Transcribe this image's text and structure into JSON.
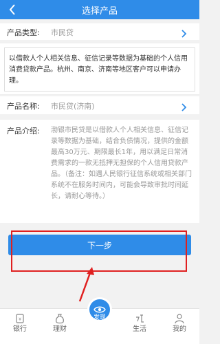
{
  "header": {
    "title": "选择产品"
  },
  "product_type": {
    "label": "产品类型:",
    "value": "市民贷"
  },
  "description": "以借款人个人相关信息、征信记录等数据为基础的个人信用消费贷款产品。杭州、南京、济南等地区客户可以申请办理。",
  "product_name": {
    "label": "产品名称:",
    "value": "市民贷(济南)"
  },
  "product_intro": {
    "label": "产品介绍:",
    "text": "渤银市民贷是以借款人个人相关信息、征信记录等数据为基础，结合负债情况，提供的金额最高30万元、期限最长1年，用以满足日常消费需求的一款无抵押无担保的个人信用贷款产品。（备注：如遇人民银行征信系统或相关部门系统不在服务时间内，可能会导致审批时间延长，请耐心等待。）"
  },
  "next_button": "下一步",
  "tabbar": {
    "bank": "银行",
    "finance": "理财",
    "discover": "发现",
    "life": "生活",
    "mine": "我的"
  },
  "colors": {
    "brand": "#2f8ce8",
    "highlight": "#e02020"
  }
}
